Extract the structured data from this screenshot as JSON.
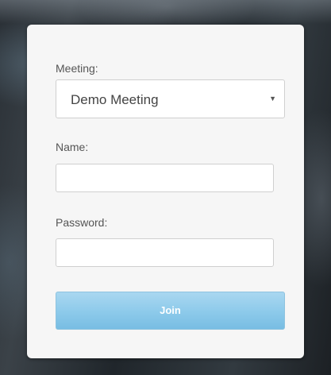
{
  "form": {
    "meeting_label": "Meeting:",
    "meeting_selected": "Demo Meeting",
    "meeting_caret": "▼",
    "name_label": "Name:",
    "name_value": "",
    "password_label": "Password:",
    "password_value": "",
    "join_label": "Join"
  },
  "colors": {
    "card_background": "#f6f6f6",
    "label_text": "#555555",
    "join_button": "#8fcbeb",
    "join_text": "#ffffff"
  }
}
